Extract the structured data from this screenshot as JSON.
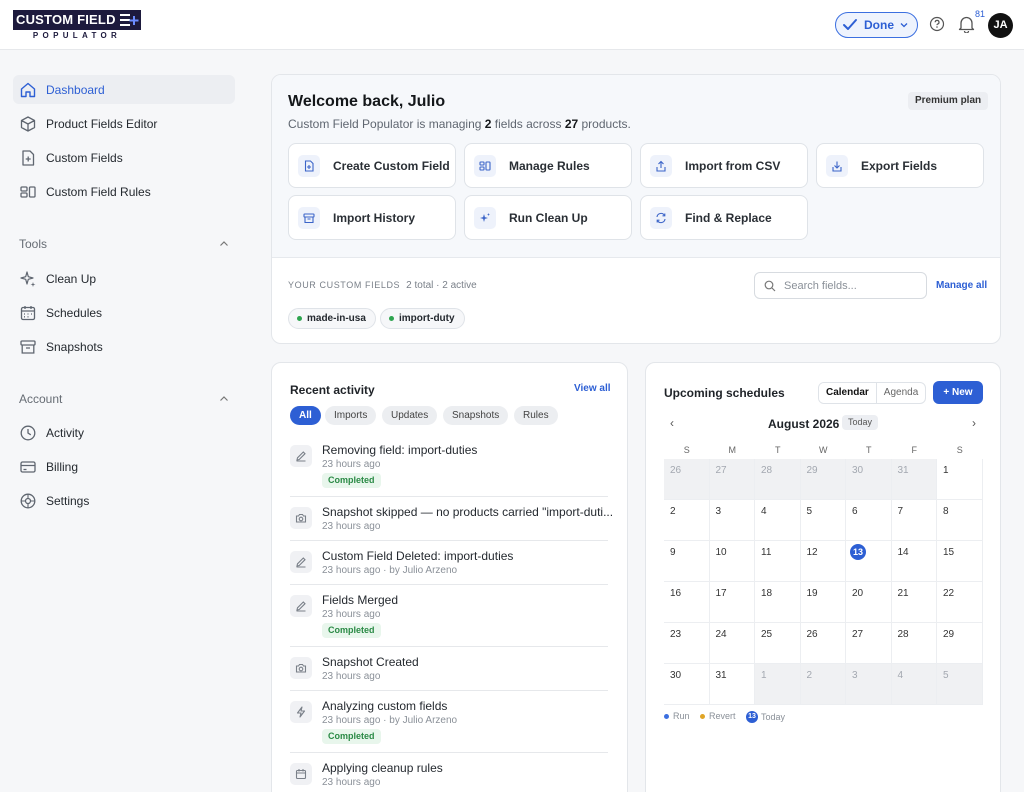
{
  "header": {
    "logo_main": "CUSTOM FIELD",
    "logo_sub": "POPULATOR",
    "done_label": "Done",
    "notification_count": "81",
    "avatar_initials": "JA"
  },
  "sidebar": {
    "items": [
      {
        "label": "Dashboard",
        "icon": "home-icon"
      },
      {
        "label": "Product Fields Editor",
        "icon": "cube-icon"
      },
      {
        "label": "Custom Fields",
        "icon": "file-plus-icon"
      },
      {
        "label": "Custom Field Rules",
        "icon": "rules-icon"
      }
    ],
    "tools_heading": "Tools",
    "tools": [
      {
        "label": "Clean Up",
        "icon": "sparkles-icon"
      },
      {
        "label": "Schedules",
        "icon": "calendar-icon"
      },
      {
        "label": "Snapshots",
        "icon": "archive-icon"
      }
    ],
    "account_heading": "Account",
    "account": [
      {
        "label": "Activity",
        "icon": "clock-icon"
      },
      {
        "label": "Billing",
        "icon": "card-icon"
      },
      {
        "label": "Settings",
        "icon": "gear-icon"
      }
    ]
  },
  "welcome": {
    "title": "Welcome back, Julio",
    "sub_prefix": "Custom Field Populator is managing ",
    "field_count": "2",
    "sub_mid": " fields across ",
    "product_count": "27",
    "sub_suffix": " products.",
    "plan": "Premium plan",
    "actions": [
      "Create Custom Field",
      "Manage Rules",
      "Import from CSV",
      "Export Fields",
      "Import History",
      "Run Clean Up",
      "Find & Replace"
    ],
    "fields_heading": "YOUR CUSTOM FIELDS",
    "fields_summary": "2 total · 2 active",
    "search_placeholder": "Search fields...",
    "manage_all": "Manage all",
    "fields": [
      "made-in-usa",
      "import-duty"
    ]
  },
  "activity": {
    "title": "Recent activity",
    "view_all": "View all",
    "tabs": [
      "All",
      "Imports",
      "Updates",
      "Snapshots",
      "Rules"
    ],
    "items": [
      {
        "title": "Removing field: import-duties",
        "meta": "23 hours ago",
        "status": "Completed"
      },
      {
        "title": "Snapshot skipped — no products carried \"import-duti...",
        "meta": "23 hours ago",
        "status": ""
      },
      {
        "title": "Custom Field Deleted: import-duties",
        "meta": "23 hours ago · by Julio Arzeno",
        "status": ""
      },
      {
        "title": "Fields Merged",
        "meta": "23 hours ago",
        "status": "Completed"
      },
      {
        "title": "Snapshot Created",
        "meta": "23 hours ago",
        "status": ""
      },
      {
        "title": "Analyzing custom fields",
        "meta": "23 hours ago · by Julio Arzeno",
        "status": "Completed"
      },
      {
        "title": "Applying cleanup rules",
        "meta": "23 hours ago",
        "status": ""
      }
    ]
  },
  "schedules": {
    "title": "Upcoming schedules",
    "view_calendar": "Calendar",
    "view_agenda": "Agenda",
    "new_label": "+ New",
    "prev": "‹",
    "next": "›",
    "month": "August 2026",
    "today_label": "Today",
    "weekdays": [
      "S",
      "M",
      "T",
      "W",
      "T",
      "F",
      "S"
    ],
    "days": [
      {
        "d": "26",
        "muted": true
      },
      {
        "d": "27",
        "muted": true
      },
      {
        "d": "28",
        "muted": true
      },
      {
        "d": "29",
        "muted": true
      },
      {
        "d": "30",
        "muted": true
      },
      {
        "d": "31",
        "muted": true
      },
      {
        "d": "1"
      },
      {
        "d": "2"
      },
      {
        "d": "3"
      },
      {
        "d": "4"
      },
      {
        "d": "5"
      },
      {
        "d": "6"
      },
      {
        "d": "7"
      },
      {
        "d": "8"
      },
      {
        "d": "9"
      },
      {
        "d": "10"
      },
      {
        "d": "11"
      },
      {
        "d": "12"
      },
      {
        "d": "13",
        "today": true
      },
      {
        "d": "14"
      },
      {
        "d": "15"
      },
      {
        "d": "16"
      },
      {
        "d": "17"
      },
      {
        "d": "18"
      },
      {
        "d": "19"
      },
      {
        "d": "20"
      },
      {
        "d": "21"
      },
      {
        "d": "22"
      },
      {
        "d": "23"
      },
      {
        "d": "24"
      },
      {
        "d": "25"
      },
      {
        "d": "26"
      },
      {
        "d": "27"
      },
      {
        "d": "28"
      },
      {
        "d": "29"
      },
      {
        "d": "30"
      },
      {
        "d": "31"
      },
      {
        "d": "1",
        "muted": true
      },
      {
        "d": "2",
        "muted": true
      },
      {
        "d": "3",
        "muted": true
      },
      {
        "d": "4",
        "muted": true
      },
      {
        "d": "5",
        "muted": true
      }
    ],
    "legend_run": "Run",
    "legend_revert": "Revert",
    "legend_today_num": "13",
    "legend_today": "Today"
  },
  "colors": {
    "accent": "#2d5fd4",
    "run": "#3b6fe0",
    "revert": "#e0a526",
    "completed": "#2a8a45"
  }
}
